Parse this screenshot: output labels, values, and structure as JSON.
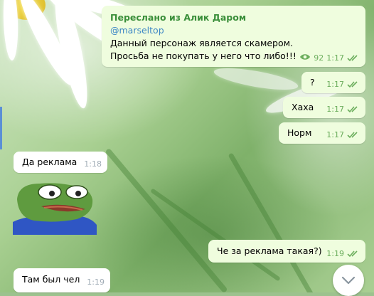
{
  "chat": {
    "forwarded": {
      "title": "Переслано из Алик Даром",
      "username": "@marseltop",
      "lines": [
        "Данный персонаж является скамером.",
        "Просьба не покупать у него что либо!!!"
      ],
      "views": "92",
      "time": "1:17"
    },
    "messages": [
      {
        "text": "?",
        "time": "1:17",
        "direction": "out"
      },
      {
        "text": "Хаха",
        "time": "1:17",
        "direction": "out"
      },
      {
        "text": "Норм",
        "time": "1:17",
        "direction": "out"
      },
      {
        "text": "Да реклама",
        "time": "1:18",
        "direction": "in"
      },
      {
        "text": "Че за реклама такая?)",
        "time": "1:19",
        "direction": "out"
      },
      {
        "text": "Там был чел",
        "time": "1:19",
        "direction": "in"
      }
    ],
    "sticker": "pepe-frog-sticker"
  },
  "colors": {
    "outgoing_bubble": "#effdde",
    "incoming_bubble": "#ffffff",
    "forward_title": "#3a8f3a",
    "username_link": "#3d88c5",
    "read_check": "#6cae5d"
  },
  "icons": {
    "views": "eye-icon",
    "read": "double-check-icon",
    "scroll": "chevron-down-icon"
  }
}
